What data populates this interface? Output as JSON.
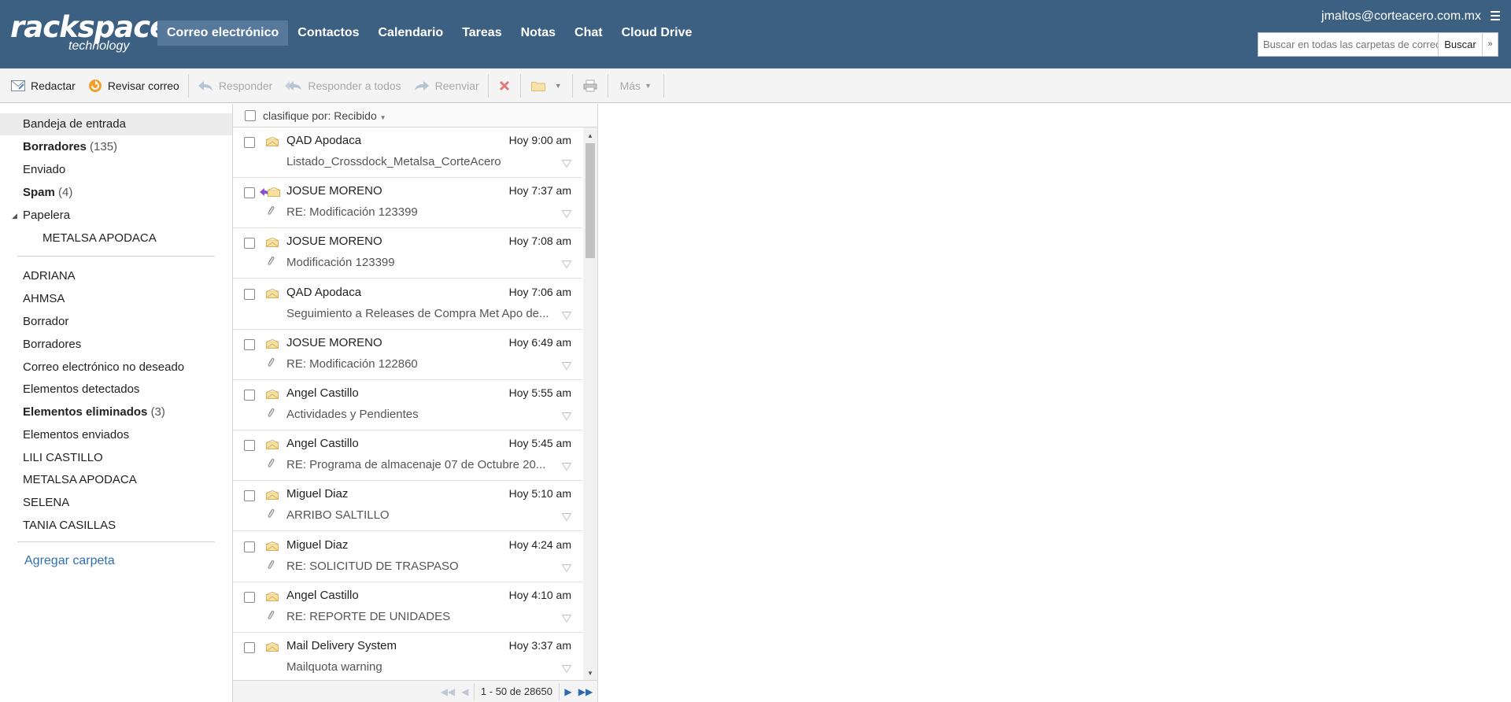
{
  "logo": {
    "line1": "rackspace",
    "line2": "technology"
  },
  "nav": [
    {
      "label": "Correo electrónico"
    },
    {
      "label": "Contactos"
    },
    {
      "label": "Calendario"
    },
    {
      "label": "Tareas"
    },
    {
      "label": "Notas"
    },
    {
      "label": "Chat"
    },
    {
      "label": "Cloud Drive"
    }
  ],
  "user": {
    "email": "jmaltos@corteacero.com.mx"
  },
  "search": {
    "placeholder": "Buscar en todas las carpetas de correo",
    "button": "Buscar"
  },
  "toolbar": {
    "compose": "Redactar",
    "check": "Revisar correo",
    "reply": "Responder",
    "reply_all": "Responder a todos",
    "forward": "Reenviar",
    "more": "Más"
  },
  "folders": [
    {
      "name": "Bandeja de entrada",
      "count": "",
      "bold": false,
      "selected": true
    },
    {
      "name": "Borradores",
      "count": "(135)",
      "bold": true
    },
    {
      "name": "Enviado",
      "count": ""
    },
    {
      "name": "Spam",
      "count": "(4)",
      "bold": true
    },
    {
      "name": "Papelera",
      "count": ""
    },
    {
      "name": "METALSA APODACA",
      "count": ""
    }
  ],
  "custom_folders": [
    {
      "name": "ADRIANA",
      "count": ""
    },
    {
      "name": "AHMSA",
      "count": ""
    },
    {
      "name": "Borrador",
      "count": ""
    },
    {
      "name": "Borradores",
      "count": ""
    },
    {
      "name": "Correo electrónico no deseado",
      "count": ""
    },
    {
      "name": "Elementos detectados",
      "count": ""
    },
    {
      "name": "Elementos eliminados",
      "count": "(3)",
      "bold": true
    },
    {
      "name": "Elementos enviados",
      "count": ""
    },
    {
      "name": "LILI CASTILLO",
      "count": ""
    },
    {
      "name": "METALSA APODACA",
      "count": ""
    },
    {
      "name": "SELENA",
      "count": ""
    },
    {
      "name": "TANIA CASILLAS",
      "count": ""
    }
  ],
  "add_folder": "Agregar carpeta",
  "list": {
    "sort_label": "clasifique por: Recibido",
    "pager": "1 - 50 de 28650",
    "messages": [
      {
        "from": "QAD Apodaca",
        "time": "Hoy 9:00 am",
        "subject": "Listado_Crossdock_Metalsa_CorteAcero",
        "attachment": false,
        "replied": false
      },
      {
        "from": "JOSUE MORENO",
        "time": "Hoy 7:37 am",
        "subject": "RE: Modificación 123399",
        "attachment": true,
        "replied": true
      },
      {
        "from": "JOSUE MORENO",
        "time": "Hoy 7:08 am",
        "subject": "Modificación 123399",
        "attachment": true,
        "replied": false
      },
      {
        "from": "QAD Apodaca",
        "time": "Hoy 7:06 am",
        "subject": "Seguimiento a Releases de Compra Met Apo de...",
        "attachment": false,
        "replied": false
      },
      {
        "from": "JOSUE MORENO",
        "time": "Hoy 6:49 am",
        "subject": "RE: Modificación 122860",
        "attachment": true,
        "replied": false
      },
      {
        "from": "Angel Castillo",
        "time": "Hoy 5:55 am",
        "subject": "Actividades y Pendientes",
        "attachment": true,
        "replied": false
      },
      {
        "from": "Angel Castillo",
        "time": "Hoy 5:45 am",
        "subject": "RE: Programa de almacenaje 07 de Octubre 20...",
        "attachment": true,
        "replied": false
      },
      {
        "from": "Miguel Diaz",
        "time": "Hoy 5:10 am",
        "subject": "ARRIBO SALTILLO",
        "attachment": true,
        "replied": false
      },
      {
        "from": "Miguel Diaz",
        "time": "Hoy 4:24 am",
        "subject": "RE: SOLICITUD DE TRASPASO",
        "attachment": true,
        "replied": false
      },
      {
        "from": "Angel Castillo",
        "time": "Hoy 4:10 am",
        "subject": "RE: REPORTE DE UNIDADES",
        "attachment": true,
        "replied": false
      },
      {
        "from": "Mail Delivery System",
        "time": "Hoy 3:37 am",
        "subject": "Mailquota warning",
        "attachment": false,
        "replied": false
      }
    ]
  }
}
